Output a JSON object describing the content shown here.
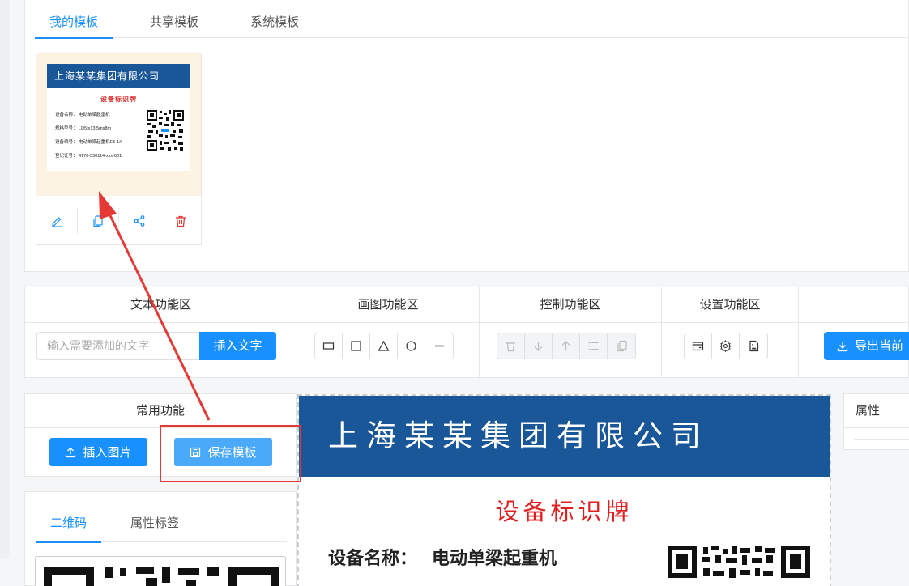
{
  "tabs": {
    "my_templates": "我的模板",
    "shared_templates": "共享模板",
    "system_templates": "系统模板"
  },
  "template_card": {
    "preview": {
      "company": "上海某某集团有限公司",
      "subtitle": "设备标识牌",
      "rows": [
        {
          "label": "设备名称：",
          "value": "电动单梁起重机"
        },
        {
          "label": "规格型号：",
          "value": "LD5tx13.5mx8m"
        },
        {
          "label": "设备编号：",
          "value": "电动单梁起重机E5-1#"
        },
        {
          "label": "登记证号：",
          "value": "4170-530114-xxx-001"
        }
      ]
    },
    "actions": [
      "edit-icon",
      "copy-icon",
      "share-icon",
      "delete-icon"
    ]
  },
  "toolbar": {
    "text_area": {
      "title": "文本功能区",
      "input_placeholder": "输入需要添加的文字",
      "insert_label": "插入文字"
    },
    "draw_area": {
      "title": "画图功能区",
      "tools": [
        "rectangle-wide-icon",
        "square-icon",
        "triangle-icon",
        "circle-icon",
        "line-icon"
      ]
    },
    "control_area": {
      "title": "控制功能区",
      "tools": [
        "delete-icon",
        "arrow-down-icon",
        "arrow-up-icon",
        "list-icon",
        "copy-icon"
      ]
    },
    "settings_area": {
      "title": "设置功能区",
      "tools": [
        "card-icon",
        "gear-icon",
        "image-file-icon"
      ]
    },
    "export_label": "导出当前"
  },
  "common": {
    "title": "常用功能",
    "insert_image": "插入图片",
    "save_template": "保存模板"
  },
  "qr_panel": {
    "tab_qr": "二维码",
    "tab_attr": "属性标签"
  },
  "canvas": {
    "company": "上海某某集团有限公司",
    "subtitle": "设备标识牌",
    "row_label": "设备名称：",
    "row_value": "电动单梁起重机"
  },
  "properties": {
    "title": "属性"
  },
  "colors": {
    "primary": "#1890ff",
    "header_blue": "#1a5799",
    "red": "#e02020",
    "annotation_red": "#e53935"
  }
}
